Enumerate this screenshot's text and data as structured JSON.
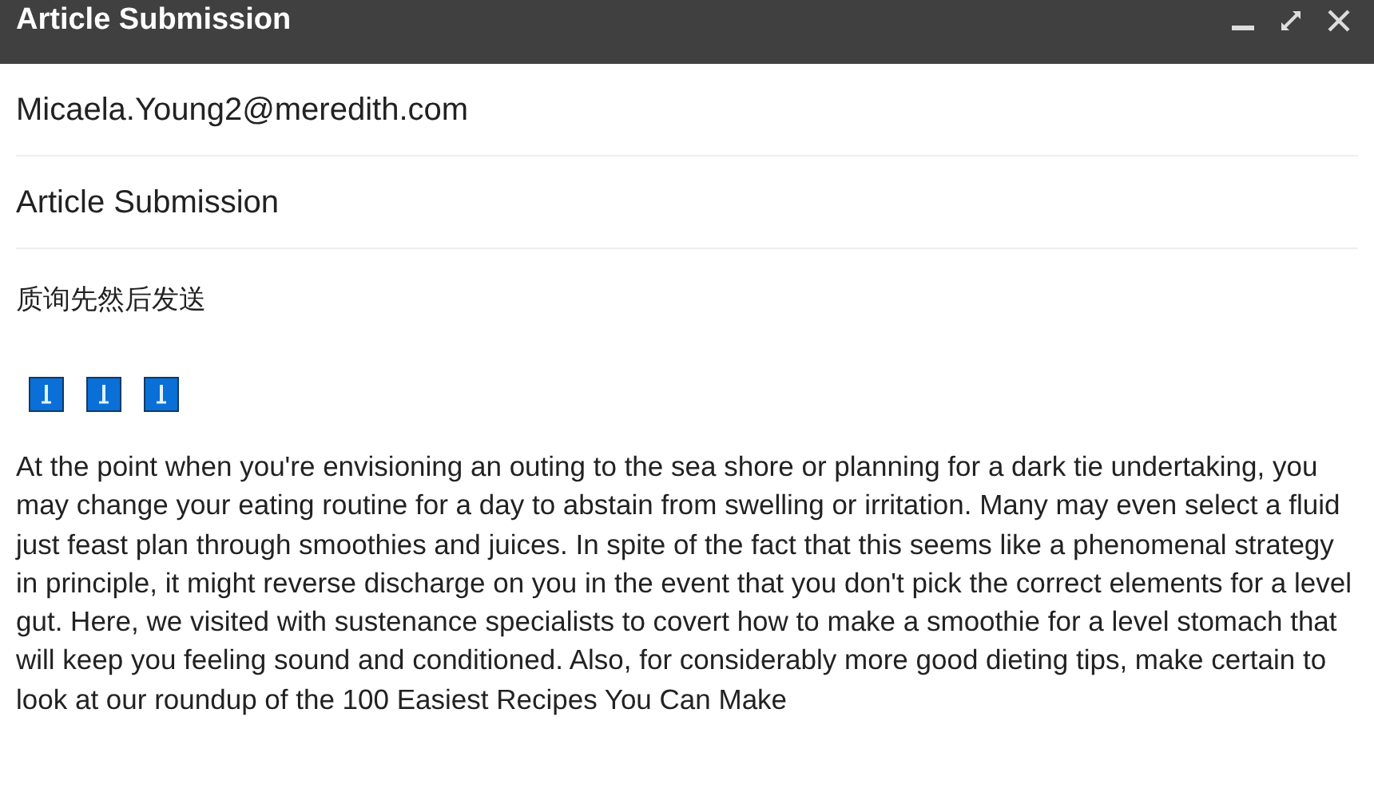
{
  "window": {
    "title": "Article Submission"
  },
  "recipient": "Micaela.Young2@meredith.com",
  "subject": "Article Submission",
  "note": "质询先然后发送",
  "attachments": [
    {
      "kind": "download"
    },
    {
      "kind": "download"
    },
    {
      "kind": "download"
    }
  ],
  "body": "At the point when you're envisioning an outing to the sea shore or planning for a dark tie undertaking, you may change your eating routine for a day to abstain from swelling or irritation. Many may even select a fluid just feast plan through smoothies and juices. In spite of the fact that this seems like a phenomenal strategy in principle, it might reverse discharge on you in the event that you don't pick the correct elements for a level gut. Here, we visited with sustenance specialists to covert how to make a smoothie for a level stomach that will keep you feeling sound and conditioned. Also, for considerably more good dieting tips, make certain to look at our roundup of the 100 Easiest Recipes You Can Make"
}
